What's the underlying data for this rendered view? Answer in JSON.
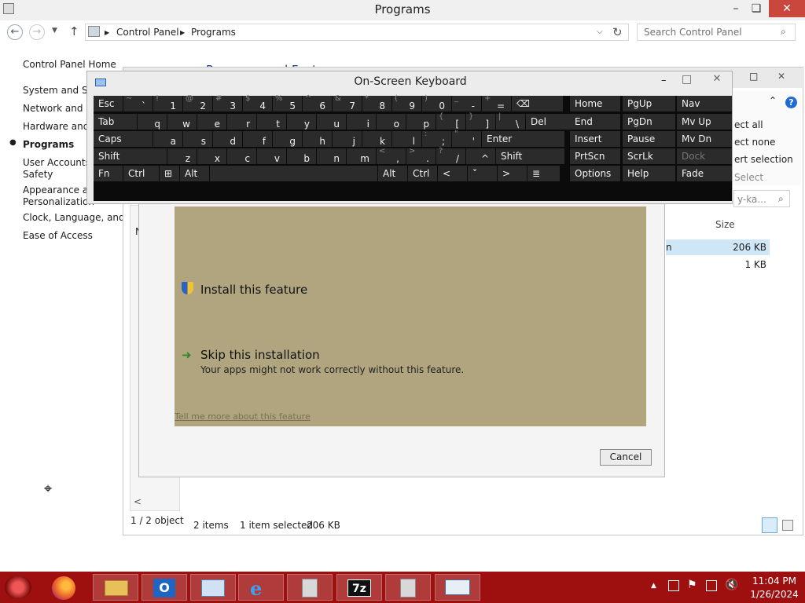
{
  "window": {
    "title": "Programs",
    "min": "–",
    "max": "❏",
    "close": "✕"
  },
  "nav": {
    "back": "←",
    "forward": "→",
    "up": "↑",
    "crumb1": "Control Panel",
    "crumb2": "Programs",
    "refresh": "↻",
    "search_placeholder": "Search Control Panel"
  },
  "sidebar": {
    "items": [
      {
        "label": "Control Panel Home"
      },
      {
        "label": "System and Sec"
      },
      {
        "label": "Network and In"
      },
      {
        "label": "Hardware and S"
      },
      {
        "label": "Programs"
      },
      {
        "label": "User Accounts a"
      },
      {
        "label": "Safety"
      },
      {
        "label": "Appearance and"
      },
      {
        "label": "Personalization"
      },
      {
        "label": "Clock, Language, and Re"
      },
      {
        "label": "Ease of Access"
      }
    ]
  },
  "behind": {
    "heading": "Programs and Features",
    "select_all": "ect all",
    "select_none": "ect none",
    "invert": "ert selection",
    "select": "Select",
    "search_text": "y-ka...",
    "size_header": "Size",
    "row1_size": "206 KB",
    "row1_tail": "n",
    "row2_size": "1 KB",
    "left_header": "N",
    "objects": "1 / 2 object",
    "items_count": "2 items",
    "selected": "1 item selected",
    "selected_size": "206 KB",
    "scroll_left": "<"
  },
  "osk": {
    "title": "On-Screen Keyboard",
    "min": "–",
    "max": "□",
    "close": "✕",
    "row1": [
      {
        "main": "Esc",
        "sub": ""
      },
      {
        "main": "`",
        "sub": "~"
      },
      {
        "main": "1",
        "sub": "!"
      },
      {
        "main": "2",
        "sub": "@"
      },
      {
        "main": "3",
        "sub": "#"
      },
      {
        "main": "4",
        "sub": "$"
      },
      {
        "main": "5",
        "sub": "%"
      },
      {
        "main": "6",
        "sub": "^"
      },
      {
        "main": "7",
        "sub": "&"
      },
      {
        "main": "8",
        "sub": "*"
      },
      {
        "main": "9",
        "sub": "("
      },
      {
        "main": "0",
        "sub": ")"
      },
      {
        "main": "-",
        "sub": "_"
      },
      {
        "main": "=",
        "sub": "+"
      },
      {
        "main": "⌫",
        "sub": ""
      }
    ],
    "row2": [
      {
        "main": "Tab",
        "sub": ""
      },
      {
        "main": "q",
        "sub": ""
      },
      {
        "main": "w",
        "sub": ""
      },
      {
        "main": "e",
        "sub": ""
      },
      {
        "main": "r",
        "sub": ""
      },
      {
        "main": "t",
        "sub": ""
      },
      {
        "main": "y",
        "sub": ""
      },
      {
        "main": "u",
        "sub": ""
      },
      {
        "main": "i",
        "sub": ""
      },
      {
        "main": "o",
        "sub": ""
      },
      {
        "main": "p",
        "sub": ""
      },
      {
        "main": "[",
        "sub": "{"
      },
      {
        "main": "]",
        "sub": "}"
      },
      {
        "main": "\\",
        "sub": "|"
      },
      {
        "main": "Del",
        "sub": ""
      }
    ],
    "row3": [
      {
        "main": "Caps",
        "sub": ""
      },
      {
        "main": "a",
        "sub": ""
      },
      {
        "main": "s",
        "sub": ""
      },
      {
        "main": "d",
        "sub": ""
      },
      {
        "main": "f",
        "sub": ""
      },
      {
        "main": "g",
        "sub": ""
      },
      {
        "main": "h",
        "sub": ""
      },
      {
        "main": "j",
        "sub": ""
      },
      {
        "main": "k",
        "sub": ""
      },
      {
        "main": "l",
        "sub": ""
      },
      {
        "main": ";",
        "sub": ":"
      },
      {
        "main": "'",
        "sub": "\""
      },
      {
        "main": "Enter",
        "sub": ""
      }
    ],
    "row4": [
      {
        "main": "Shift",
        "sub": ""
      },
      {
        "main": "z",
        "sub": ""
      },
      {
        "main": "x",
        "sub": ""
      },
      {
        "main": "c",
        "sub": ""
      },
      {
        "main": "v",
        "sub": ""
      },
      {
        "main": "b",
        "sub": ""
      },
      {
        "main": "n",
        "sub": ""
      },
      {
        "main": "m",
        "sub": ""
      },
      {
        "main": ",",
        "sub": "<"
      },
      {
        "main": ".",
        "sub": ">"
      },
      {
        "main": "/",
        "sub": "?"
      },
      {
        "main": "^",
        "sub": ""
      },
      {
        "main": "Shift",
        "sub": ""
      }
    ],
    "row5": [
      {
        "main": "Fn",
        "sub": ""
      },
      {
        "main": "Ctrl",
        "sub": ""
      },
      {
        "main": "⊞",
        "sub": ""
      },
      {
        "main": "Alt",
        "sub": ""
      },
      {
        "main": "",
        "sub": ""
      },
      {
        "main": "Alt",
        "sub": ""
      },
      {
        "main": "Ctrl",
        "sub": ""
      },
      {
        "main": "<",
        "sub": ""
      },
      {
        "main": "˅",
        "sub": ""
      },
      {
        "main": ">",
        "sub": ""
      },
      {
        "main": "≣",
        "sub": ""
      }
    ],
    "nav": [
      [
        "Home",
        "PgUp",
        "Nav"
      ],
      [
        "End",
        "PgDn",
        "Mv Up"
      ],
      [
        "Insert",
        "Pause",
        "Mv Dn"
      ],
      [
        "PrtScn",
        "ScrLk",
        "Dock"
      ],
      [
        "Options",
        "Help",
        "Fade"
      ]
    ]
  },
  "dialog": {
    "install": "Install this feature",
    "skip": "Skip this installation",
    "skip_desc": "Your apps might not work correctly without this feature.",
    "tell_more": "Tell me more about this feature",
    "cancel": "Cancel"
  },
  "taskbar": {
    "time": "11:04 PM",
    "date": "1/26/2024",
    "app7z": "7z"
  },
  "colors": {
    "taskbar": "#9e1010",
    "olive": "#b0a57f",
    "osk_key": "#2b2b2b"
  }
}
